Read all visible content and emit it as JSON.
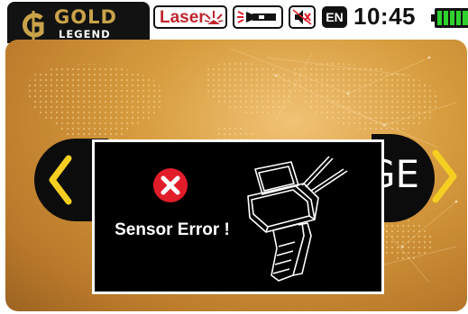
{
  "logo": {
    "line1": "GOLD",
    "line2": "LEGEND"
  },
  "status": {
    "laser_label": "Laser",
    "language": "EN",
    "time": "10:45",
    "battery_level": 1.0
  },
  "icons": {
    "logo": "g-dollar-icon",
    "laser": "laser-beam-icon",
    "torch": "flashlight-icon",
    "sound": "speaker-muted-icon",
    "battery": "battery-full-icon",
    "nav_prev": "chevron-left-icon",
    "nav_next": "chevron-right-icon",
    "error": "error-x-icon",
    "device": "detector-device-icon"
  },
  "nav": {
    "next_partial_label": "GE"
  },
  "dialog": {
    "message": "Sensor Error !"
  },
  "colors": {
    "accent_gold": "#c9a34a",
    "chevron_yellow": "#f4cf22",
    "error_red": "#e11d2a",
    "battery_green": "#2fd12f",
    "laser_red": "#c0262d"
  }
}
